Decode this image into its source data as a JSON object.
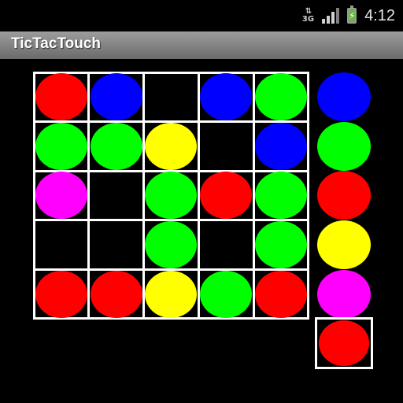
{
  "status_bar": {
    "network": "3G",
    "time": "4:12",
    "signal_bars_on": 3,
    "signal_bars_total": 4
  },
  "app": {
    "title": "TicTacTouch"
  },
  "colors": {
    "red": "#ff0000",
    "blue": "#0000ff",
    "green": "#00ff00",
    "yellow": "#ffff00",
    "magenta": "#ff00ff"
  },
  "board": {
    "rows": [
      [
        "red",
        "blue",
        "empty",
        "blue",
        "green"
      ],
      [
        "green",
        "green",
        "yellow",
        "empty",
        "blue"
      ],
      [
        "magenta",
        "empty",
        "green",
        "red",
        "green"
      ],
      [
        "empty",
        "empty",
        "green",
        "empty",
        "green"
      ],
      [
        "red",
        "red",
        "yellow",
        "green",
        "red"
      ]
    ]
  },
  "palette": {
    "options": [
      "blue",
      "green",
      "red",
      "yellow",
      "magenta"
    ],
    "selected": "red"
  }
}
